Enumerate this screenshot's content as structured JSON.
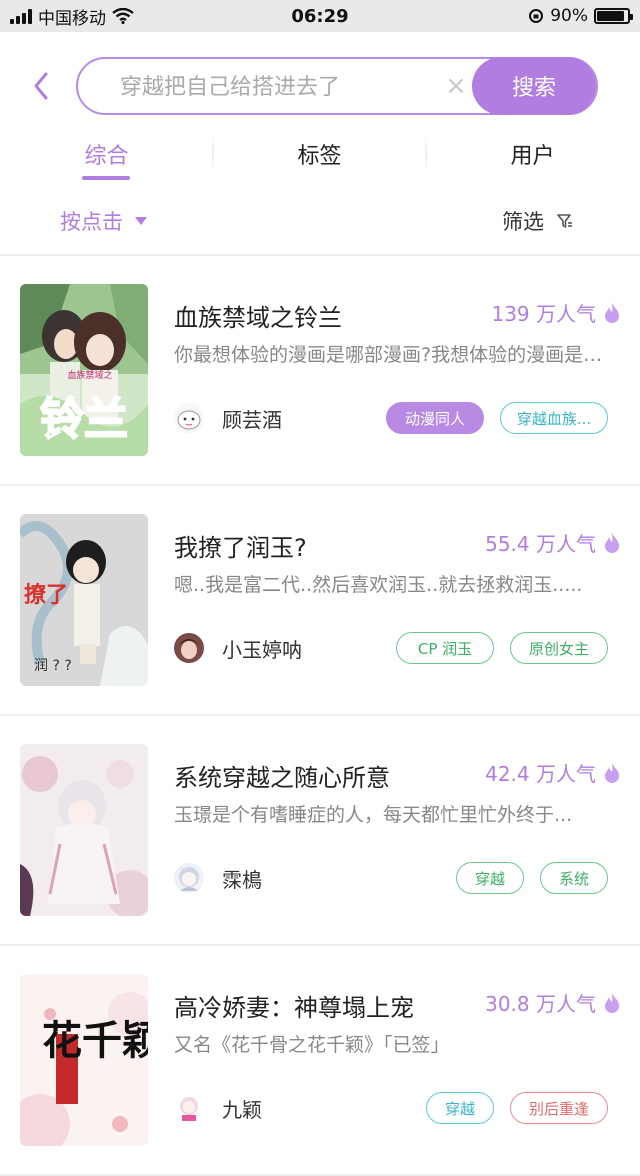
{
  "status_bar": {
    "carrier": "中国移动",
    "time": "06:29",
    "battery_text": "90%",
    "battery_level": 0.9
  },
  "search": {
    "placeholder": "穿越把自己给搭进去了",
    "clear_symbol": "×",
    "button_label": "搜索"
  },
  "tabs": [
    {
      "label": "综合"
    },
    {
      "label": "标签"
    },
    {
      "label": "用户"
    }
  ],
  "filters": {
    "sort_label": "按点击",
    "filter_label": "筛选"
  },
  "results": [
    {
      "title": "血族禁域之铃兰",
      "popularity": "139 万人气",
      "description": "你最想体验的漫画是哪部漫画?我想体验的漫画是……",
      "author": "顾芸酒",
      "tags": [
        "动漫同人",
        "穿越血族..."
      ],
      "cover_text": "铃兰",
      "cover_badge": "血族禁域之"
    },
    {
      "title": "我撩了润玉?",
      "popularity": "55.4 万人气",
      "description": "嗯..我是富二代..然后喜欢润玉..就去拯救润玉.....",
      "author": "小玉婷呐",
      "tags": [
        "CP 润玉",
        "原创女主"
      ],
      "cover_text": "撩了",
      "cover_extra": "润 ? ?"
    },
    {
      "title": "系统穿越之随心所意",
      "popularity": "42.4 万人气",
      "description": "玉璟是个有嗜睡症的人，每天都忙里忙外终于...",
      "author": "霂樢",
      "tags": [
        "穿越",
        "系统"
      ]
    },
    {
      "title": "高冷娇妻：神尊塌上宠",
      "popularity": "30.8 万人气",
      "description": "又名《花千骨之花千颖》「已签」",
      "author": "九颖",
      "tags": [
        "穿越",
        "别后重逢"
      ],
      "cover_text": "花千颖"
    }
  ],
  "colors": {
    "accent": "#b27de1",
    "tag_cyan": "#38b4c8",
    "tag_green": "#3fae64",
    "tag_red": "#e36a6a"
  }
}
